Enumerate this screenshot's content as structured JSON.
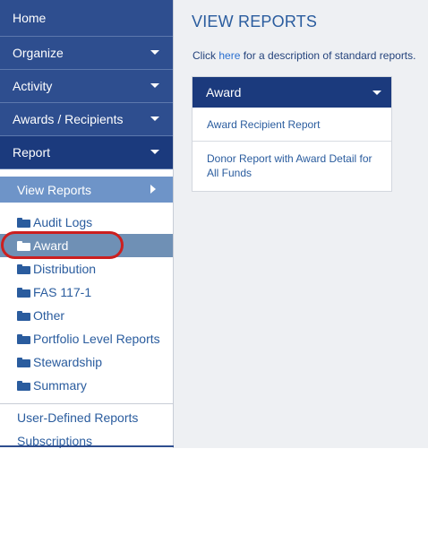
{
  "sidebar": {
    "nav": [
      {
        "label": "Home"
      },
      {
        "label": "Organize"
      },
      {
        "label": "Activity"
      },
      {
        "label": "Awards / Recipients"
      },
      {
        "label": "Report"
      }
    ],
    "subnav_label": "View Reports",
    "folders": [
      {
        "label": "Audit Logs"
      },
      {
        "label": "Award"
      },
      {
        "label": "Distribution"
      },
      {
        "label": "FAS 117-1"
      },
      {
        "label": "Other"
      },
      {
        "label": "Portfolio Level Reports"
      },
      {
        "label": "Stewardship"
      },
      {
        "label": "Summary"
      }
    ],
    "selected_folder": "Award",
    "links": [
      {
        "label": "User-Defined Reports"
      },
      {
        "label": "Subscriptions"
      }
    ]
  },
  "main": {
    "title": "VIEW REPORTS",
    "desc_prefix": "Click ",
    "desc_link": "here",
    "desc_suffix": " for a description of standard reports.",
    "panel": {
      "header": "Award",
      "reports": [
        {
          "label": "Award Recipient Report"
        },
        {
          "label": "Donor Report with Award Detail for All Funds"
        }
      ]
    }
  },
  "colors": {
    "nav_bg": "#2e4e8f",
    "nav_active_bg": "#1b3a7d",
    "subnav_bg": "#6e94c8",
    "selected_bg": "#6f90b5",
    "link": "#2a5c9e",
    "highlight_ring": "#cc1f1f",
    "main_bg": "#eef0f3"
  },
  "icons": {
    "nav_chevron": "chevron-down-icon",
    "subnav_arrow": "chevron-right-icon",
    "folder": "folder-icon"
  }
}
